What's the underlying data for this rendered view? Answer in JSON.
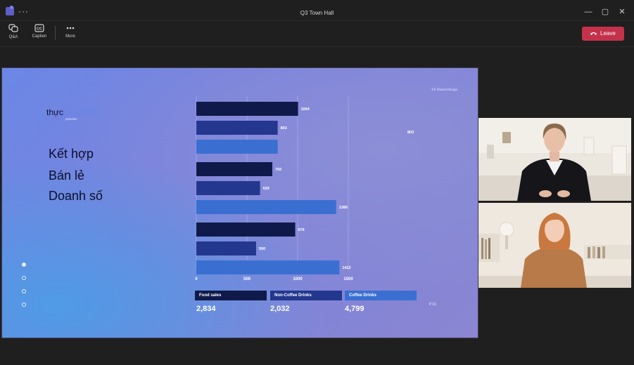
{
  "window": {
    "title": "Q3 Town Hall",
    "more_glyph": "···",
    "controls": {
      "minimize": "—",
      "maximize": "▢",
      "close": "✕"
    }
  },
  "toolbar": {
    "items": [
      {
        "label": "Q&A",
        "icon": "qa-icon"
      },
      {
        "label": "Caption",
        "icon": "caption-icon"
      },
      {
        "label": "More",
        "icon": "more-icon"
      }
    ],
    "leave_label": "Leave"
  },
  "slide": {
    "brand": "YA Shared Design",
    "kicker": "thực",
    "presents": "presents",
    "headings": [
      "Kết hợp",
      "Bán lẻ",
      "Doanh số"
    ],
    "page": "P 01",
    "dots": [
      true,
      false,
      false,
      false
    ]
  },
  "chart_data": {
    "type": "bar",
    "orientation": "horizontal",
    "xlim": [
      0,
      1500
    ],
    "ticks": [
      0,
      500,
      1000,
      1500
    ],
    "grid": true,
    "groups": [
      {
        "values": [
          1004,
          803,
          803
        ]
      },
      {
        "values": [
          750,
          629,
          1380
        ]
      },
      {
        "values": [
          976,
          590,
          1412
        ]
      }
    ],
    "legend": [
      {
        "name": "Food sales",
        "total": "2,834",
        "color": "#0f1a4a"
      },
      {
        "name": "Non-Coffee Drinks",
        "total": "2,032",
        "color": "#24378f"
      },
      {
        "name": "Coffee Drinks",
        "total": "4,799",
        "color": "#3a6fd1"
      }
    ]
  },
  "colors": {
    "leave": "#c4314b",
    "app_bg": "#1f1f1f"
  },
  "participants": [
    {
      "tile": "participant-video-1"
    },
    {
      "tile": "participant-video-2"
    }
  ]
}
